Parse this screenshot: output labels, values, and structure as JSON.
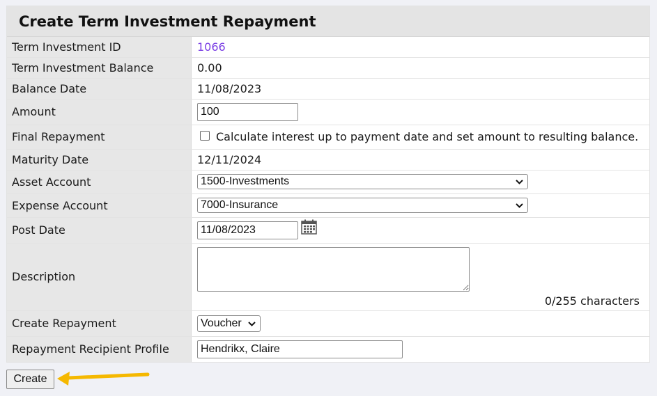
{
  "form": {
    "title": "Create Term Investment Repayment",
    "fields": {
      "term_investment_id": {
        "label": "Term Investment ID",
        "value": "1066"
      },
      "term_investment_balance": {
        "label": "Term Investment Balance",
        "value": "0.00"
      },
      "balance_date": {
        "label": "Balance Date",
        "value": "11/08/2023"
      },
      "amount": {
        "label": "Amount",
        "value": "100"
      },
      "final_repayment": {
        "label": "Final Repayment",
        "checkbox_label": "Calculate interest up to payment date and set amount to resulting balance.",
        "checked": false
      },
      "maturity_date": {
        "label": "Maturity Date",
        "value": "12/11/2024"
      },
      "asset_account": {
        "label": "Asset Account",
        "selected": "1500-Investments"
      },
      "expense_account": {
        "label": "Expense Account",
        "selected": "7000-Insurance"
      },
      "post_date": {
        "label": "Post Date",
        "value": "11/08/2023"
      },
      "description": {
        "label": "Description",
        "value": "",
        "char_count": "0/255 characters"
      },
      "create_repayment": {
        "label": "Create Repayment",
        "selected": "Voucher"
      },
      "repayment_recipient_profile": {
        "label": "Repayment Recipient Profile",
        "value": "Hendrikx, Claire"
      }
    },
    "submit_label": "Create"
  },
  "colors": {
    "link": "#7b3fe4",
    "label_bg": "#e7e7e7",
    "annotation_arrow": "#f5b800"
  },
  "icons": {
    "post_date_picker": "calendar-icon",
    "dropdown": "chevron-down-icon",
    "annotation": "arrow-left-icon"
  }
}
